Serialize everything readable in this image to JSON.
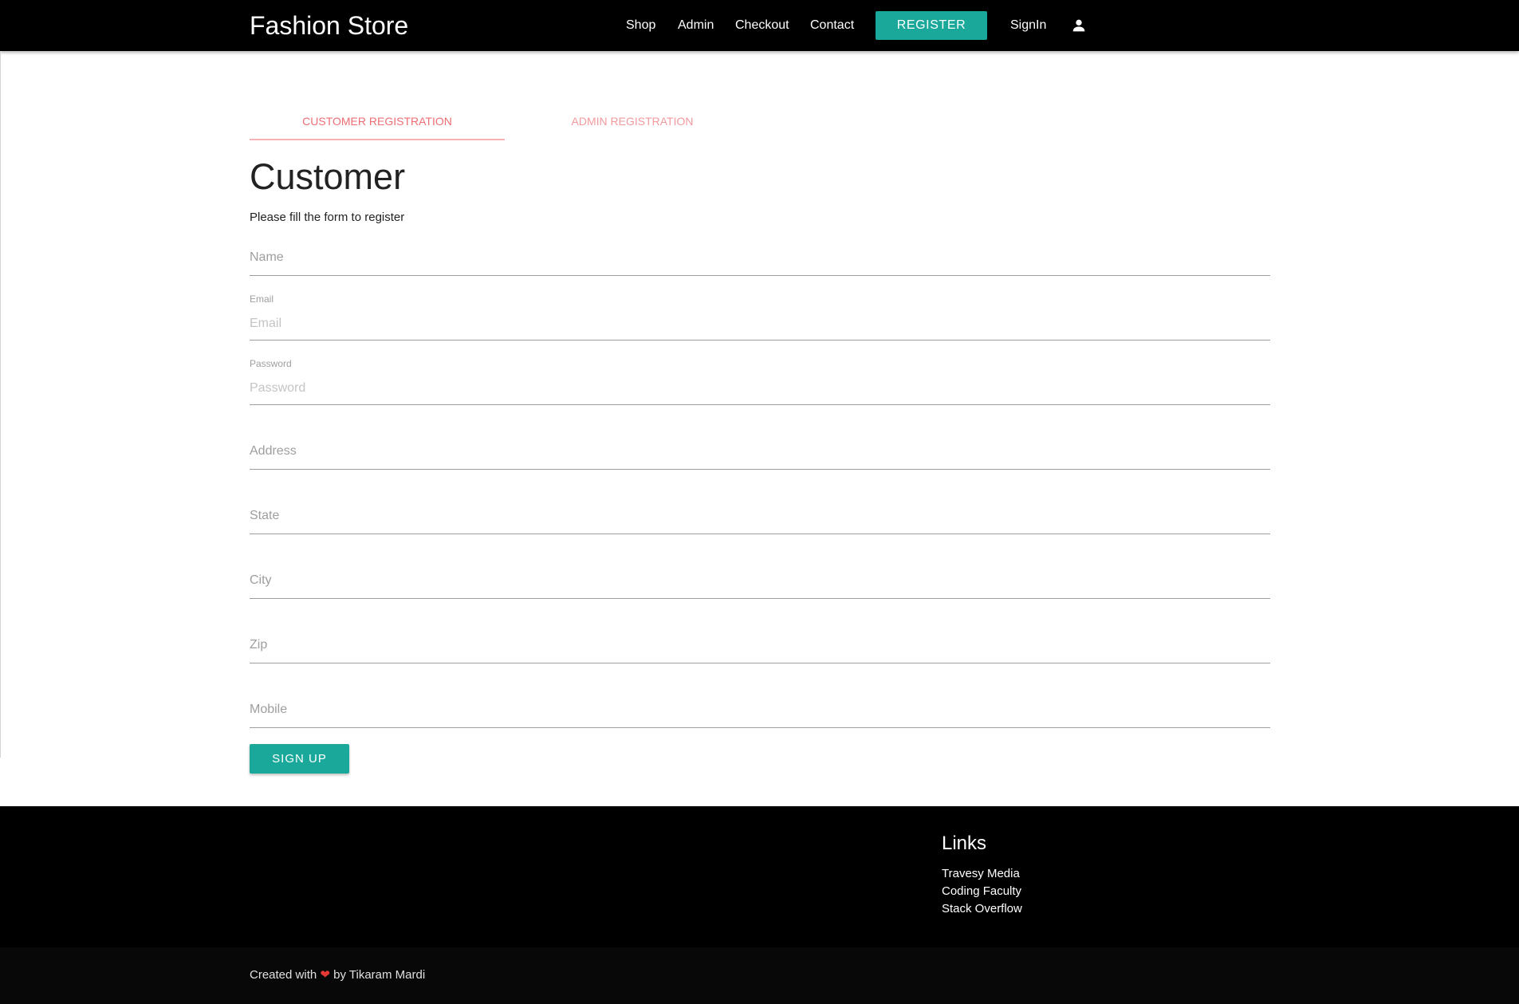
{
  "navbar": {
    "brand": "Fashion Store",
    "links": [
      "Shop",
      "Admin",
      "Checkout",
      "Contact"
    ],
    "register_label": "REGISTER",
    "signin_label": "SignIn",
    "user_icon": "person-icon"
  },
  "tabs": {
    "customer": "CUSTOMER REGISTRATION",
    "admin": "ADMIN REGISTRATION",
    "active": "customer"
  },
  "form": {
    "heading": "Customer",
    "subtitle": "Please fill the form to register",
    "name_placeholder": "Name",
    "email_label": "Email",
    "email_placeholder": "Email",
    "password_label": "Password",
    "password_placeholder": "Password",
    "address_placeholder": "Address",
    "state_placeholder": "State",
    "city_placeholder": "City",
    "zip_placeholder": "Zip",
    "mobile_placeholder": "Mobile",
    "signup_label": "SIGN UP"
  },
  "footer": {
    "links_title": "Links",
    "links": [
      "Travesy Media",
      "Coding Faculty",
      "Stack Overflow"
    ],
    "created_prefix": "Created with",
    "heart": "❤",
    "created_suffix": "by Tikaram Mardi"
  },
  "colors": {
    "accent": "#1aa89a",
    "tab_active": "#ee6e73",
    "navbar_bg": "#000000",
    "heart": "#e53935"
  }
}
